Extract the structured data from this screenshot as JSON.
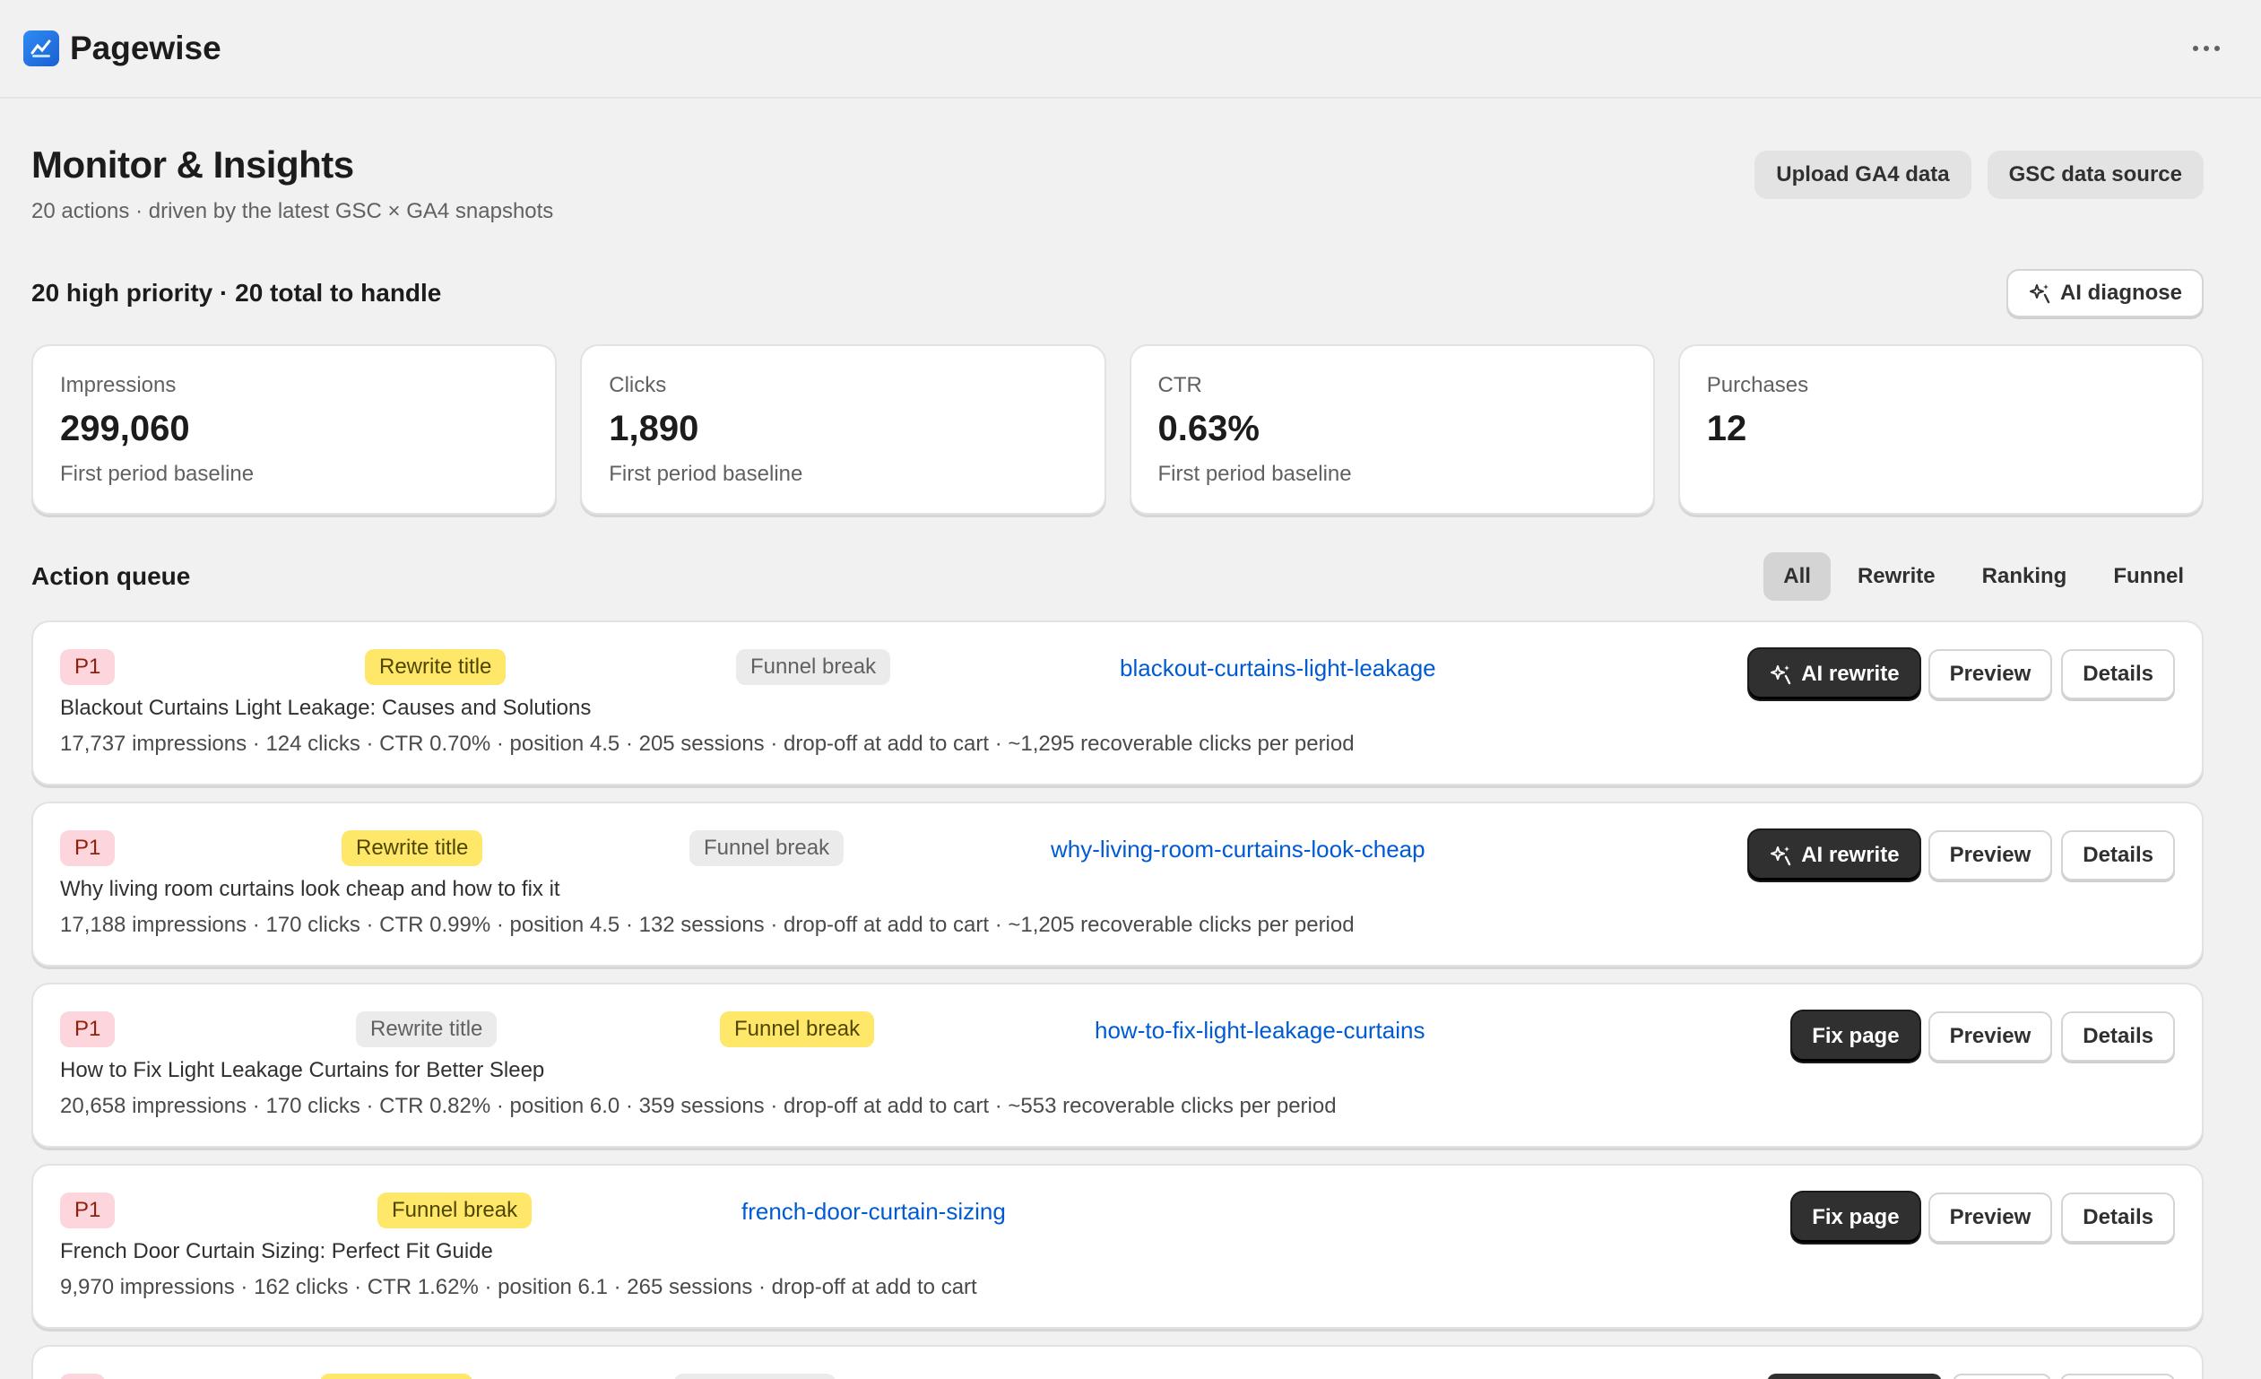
{
  "app": {
    "name": "Pagewise",
    "logo_icon": "pagewise-logo-icon",
    "more_icon": "more-horizontal-icon"
  },
  "header": {
    "title": "Monitor & Insights",
    "subtitle": "20 actions · driven by the latest GSC × GA4 snapshots",
    "upload_label": "Upload GA4 data",
    "gsc_label": "GSC data source"
  },
  "summary": {
    "text": "20 high priority · 20 total to handle",
    "diagnose_label": "AI diagnose"
  },
  "metrics": [
    {
      "label": "Impressions",
      "value": "299,060",
      "sub": "First period baseline"
    },
    {
      "label": "Clicks",
      "value": "1,890",
      "sub": "First period baseline"
    },
    {
      "label": "CTR",
      "value": "0.63%",
      "sub": "First period baseline"
    },
    {
      "label": "Purchases",
      "value": "12",
      "sub": ""
    }
  ],
  "queue": {
    "title": "Action queue",
    "tabs": [
      "All",
      "Rewrite",
      "Ranking",
      "Funnel"
    ],
    "active_tab": "All",
    "items": [
      {
        "priority": "P1",
        "tag1": "Rewrite title",
        "tag2": "Funnel break",
        "slug": "blackout-curtains-light-leakage",
        "title": "Blackout Curtains Light Leakage: Causes and Solutions",
        "stats": "17,737 impressions · 124 clicks · CTR 0.70% · position 4.5 · 205 sessions · drop-off at add to cart · ~1,295 recoverable clicks per period",
        "primary_action": "AI rewrite",
        "preview": "Preview",
        "details": "Details"
      },
      {
        "priority": "P1",
        "tag1": "Rewrite title",
        "tag2": "Funnel break",
        "slug": "why-living-room-curtains-look-cheap",
        "title": "Why living room curtains look cheap and how to fix it",
        "stats": "17,188 impressions · 170 clicks · CTR 0.99% · position 4.5 · 132 sessions · drop-off at add to cart · ~1,205 recoverable clicks per period",
        "primary_action": "AI rewrite",
        "preview": "Preview",
        "details": "Details"
      },
      {
        "priority": "P1",
        "tag1": "Rewrite title",
        "tag2": "Funnel break",
        "slug": "how-to-fix-light-leakage-curtains",
        "title": "How to Fix Light Leakage Curtains for Better Sleep",
        "stats": "20,658 impressions · 170 clicks · CTR 0.82% · position 6.0 · 359 sessions · drop-off at add to cart · ~553 recoverable clicks per period",
        "primary_action": "Fix page",
        "preview": "Preview",
        "details": "Details"
      },
      {
        "priority": "P1",
        "tag1": "Funnel break",
        "slug": "french-door-curtain-sizing",
        "title": "French Door Curtain Sizing: Perfect Fit Guide",
        "stats": "9,970 impressions · 162 clicks · CTR 1.62% · position 6.1 · 265 sessions · drop-off at add to cart",
        "primary_action": "Fix page",
        "preview": "Preview",
        "details": "Details"
      }
    ]
  },
  "colors": {
    "accent_link": "#005bd3",
    "badge_p1": "#fdd6dd",
    "badge_yellow": "#ffe769",
    "badge_gray": "#ebebeb",
    "button_dark": "#303030"
  }
}
